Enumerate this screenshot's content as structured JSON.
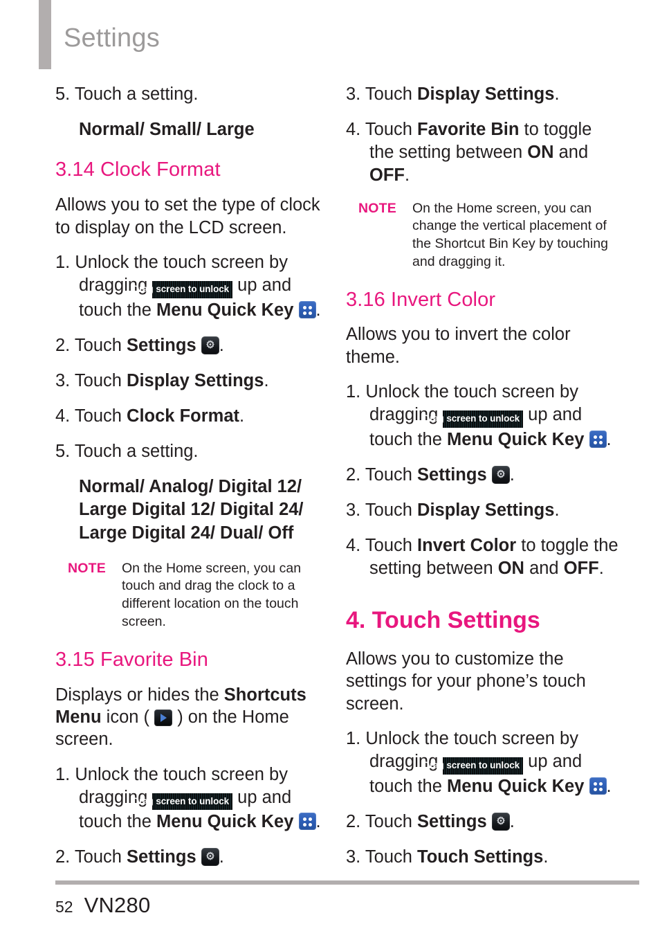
{
  "header": {
    "title": "Settings"
  },
  "icons": {
    "unlock_badge_label": "Drag screen to unlock",
    "menu_quick_key": "menu-quick-key-icon",
    "settings_gear": "settings-gear-icon",
    "shortcuts_menu": "shortcuts-menu-play-icon"
  },
  "colors": {
    "accent_magenta": "#e8177e",
    "header_gray": "#9c9a9a",
    "rule_gray": "#b2aeae",
    "body_black": "#231f20",
    "menu_key_blue": "#2e5fb8"
  },
  "left_column": {
    "step_5_prev": {
      "num": "5.",
      "text": "Touch a setting."
    },
    "options_prev": "Normal/ Small/ Large",
    "section_314": {
      "heading": "3.14 Clock Format",
      "intro": "Allows you to set the type of clock to display on the LCD screen.",
      "step1": {
        "num": "1.",
        "part1": "Unlock the touch screen by dragging",
        "part2": "up and touch the",
        "bold": "Menu Quick Key",
        "end": "."
      },
      "step2": {
        "num": "2.",
        "part1": "Touch",
        "bold": "Settings",
        "end": "."
      },
      "step3": {
        "num": "3.",
        "part1": "Touch",
        "bold": "Display Settings",
        "end": "."
      },
      "step4": {
        "num": "4.",
        "part1": "Touch",
        "bold": "Clock Format",
        "end": "."
      },
      "step5": {
        "num": "5.",
        "text": "Touch a setting."
      },
      "options": "Normal/ Analog/ Digital 12/ Large Digital 12/ Digital 24/ Large Digital 24/ Dual/ Off",
      "note": {
        "label": "NOTE",
        "body": "On the Home screen, you can touch and drag the clock to a different location on the touch screen."
      }
    },
    "section_315": {
      "heading": "3.15 Favorite Bin",
      "intro_part1": "Displays or hides the",
      "intro_bold1": "Shortcuts Menu",
      "intro_part2": "icon (",
      "intro_part3": ") on the Home screen.",
      "step1": {
        "num": "1.",
        "part1": "Unlock the touch screen by dragging",
        "part2": "up and touch the",
        "bold": "Menu Quick Key",
        "end": "."
      },
      "step2": {
        "num": "2.",
        "part1": "Touch",
        "bold": "Settings",
        "end": "."
      }
    }
  },
  "right_column": {
    "section_315_cont": {
      "step3": {
        "num": "3.",
        "part1": "Touch",
        "bold": "Display Settings",
        "end": "."
      },
      "step4": {
        "num": "4.",
        "part1": "Touch",
        "bold1": "Favorite Bin",
        "part2": "to toggle the setting between",
        "bold2": "ON",
        "part3": "and",
        "bold3": "OFF",
        "end": "."
      },
      "note": {
        "label": "NOTE",
        "body": "On the Home screen, you can change the vertical placement of the Shortcut Bin Key by touching and dragging it."
      }
    },
    "section_316": {
      "heading": "3.16 Invert Color",
      "intro": "Allows you to invert the color theme.",
      "step1": {
        "num": "1.",
        "part1": "Unlock the touch screen by dragging",
        "part2": "up and touch the",
        "bold": "Menu Quick Key",
        "end": "."
      },
      "step2": {
        "num": "2.",
        "part1": "Touch",
        "bold": "Settings",
        "end": "."
      },
      "step3": {
        "num": "3.",
        "part1": "Touch",
        "bold": "Display Settings",
        "end": "."
      },
      "step4": {
        "num": "4.",
        "part1": "Touch",
        "bold1": "Invert Color",
        "part2": "to toggle the setting between",
        "bold2": "ON",
        "part3": "and",
        "bold3": "OFF",
        "end": "."
      }
    },
    "chapter_4": {
      "heading": "4. Touch Settings",
      "intro": "Allows you to customize the settings for your phone’s touch screen.",
      "step1": {
        "num": "1.",
        "part1": "Unlock the touch screen by dragging",
        "part2": "up and touch the",
        "bold": "Menu Quick Key",
        "end": "."
      },
      "step2": {
        "num": "2.",
        "part1": "Touch",
        "bold": "Settings",
        "end": "."
      },
      "step3": {
        "num": "3.",
        "part1": "Touch",
        "bold": "Touch Settings",
        "end": "."
      }
    }
  },
  "footer": {
    "page_number": "52",
    "model": "VN280"
  }
}
